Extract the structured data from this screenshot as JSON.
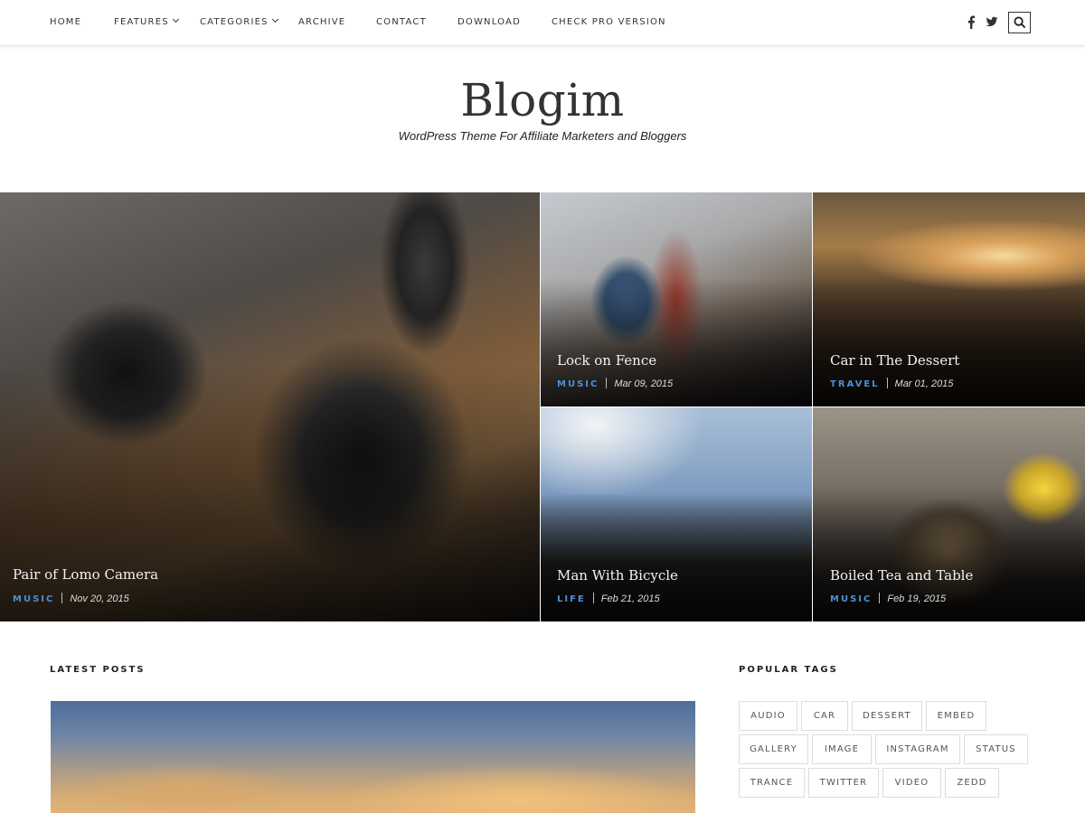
{
  "nav": {
    "items": [
      {
        "label": "HOME",
        "has_dropdown": false
      },
      {
        "label": "FEATURES",
        "has_dropdown": true
      },
      {
        "label": "CATEGORIES",
        "has_dropdown": true
      },
      {
        "label": "ARCHIVE",
        "has_dropdown": false
      },
      {
        "label": "CONTACT",
        "has_dropdown": false
      },
      {
        "label": "DOWNLOAD",
        "has_dropdown": false
      },
      {
        "label": "CHECK PRO VERSION",
        "has_dropdown": false
      }
    ],
    "social_icons": [
      "facebook-icon",
      "twitter-icon"
    ],
    "search_icon": "search-icon"
  },
  "site": {
    "title": "Blogim",
    "tagline": "WordPress Theme For Affiliate Marketers and Bloggers"
  },
  "featured": [
    {
      "title": "Pair of Lomo Camera",
      "category": "MUSIC",
      "date": "Nov 20, 2015"
    },
    {
      "title": "Lock on Fence",
      "category": "MUSIC",
      "date": "Mar 09, 2015"
    },
    {
      "title": "Car in The Dessert",
      "category": "TRAVEL",
      "date": "Mar 01, 2015"
    },
    {
      "title": "Man With Bicycle",
      "category": "LIFE",
      "date": "Feb 21, 2015"
    },
    {
      "title": "Boiled Tea and Table",
      "category": "MUSIC",
      "date": "Feb 19, 2015"
    }
  ],
  "latest_posts": {
    "heading": "LATEST POSTS"
  },
  "popular_tags": {
    "heading": "POPULAR TAGS",
    "tags": [
      "AUDIO",
      "CAR",
      "DESSERT",
      "EMBED",
      "GALLERY",
      "IMAGE",
      "INSTAGRAM",
      "STATUS",
      "TRANCE",
      "TWITTER",
      "VIDEO",
      "ZEDD"
    ]
  },
  "colors": {
    "accent": "#4a90d9",
    "text": "#222222",
    "tag_border": "#dddddd"
  }
}
